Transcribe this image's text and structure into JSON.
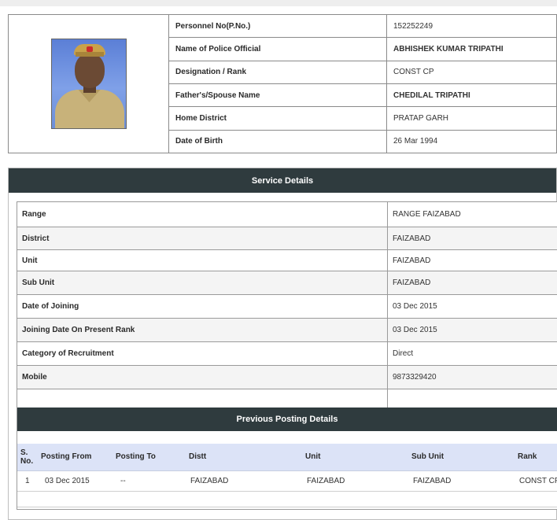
{
  "personal": {
    "rows": [
      {
        "label": "Personnel No(P.No.)",
        "value": "152252249"
      },
      {
        "label": "Name of Police Official",
        "value": "ABHISHEK KUMAR TRIPATHI"
      },
      {
        "label": "Designation / Rank",
        "value": "CONST CP"
      },
      {
        "label": "Father's/Spouse Name",
        "value": "CHEDILAL TRIPATHI"
      },
      {
        "label": "Home District",
        "value": "PRATAP GARH"
      },
      {
        "label": "Date of Birth",
        "value": "26 Mar 1994"
      }
    ]
  },
  "service": {
    "title": "Service Details",
    "rows": [
      {
        "label": "Range",
        "value": "RANGE FAIZABAD"
      },
      {
        "label": "District",
        "value": "FAIZABAD"
      },
      {
        "label": "Unit",
        "value": "FAIZABAD"
      },
      {
        "label": "Sub Unit",
        "value": "FAIZABAD"
      },
      {
        "label": "Date of Joining",
        "value": "03 Dec 2015"
      },
      {
        "label": "Joining Date On Present Rank",
        "value": "03 Dec 2015"
      },
      {
        "label": "Category of Recruitment",
        "value": "Direct"
      },
      {
        "label": "Mobile",
        "value": "9873329420"
      },
      {
        "label": "",
        "value": ""
      }
    ]
  },
  "postings": {
    "title": "Previous Posting Details",
    "headers": [
      "S. No.",
      "Posting From",
      "Posting To",
      "Distt",
      "Unit",
      "Sub Unit",
      "Rank"
    ],
    "rows": [
      [
        "1",
        "03 Dec 2015",
        "--",
        "FAIZABAD",
        "FAIZABAD",
        "FAIZABAD",
        "CONST CP"
      ]
    ]
  }
}
